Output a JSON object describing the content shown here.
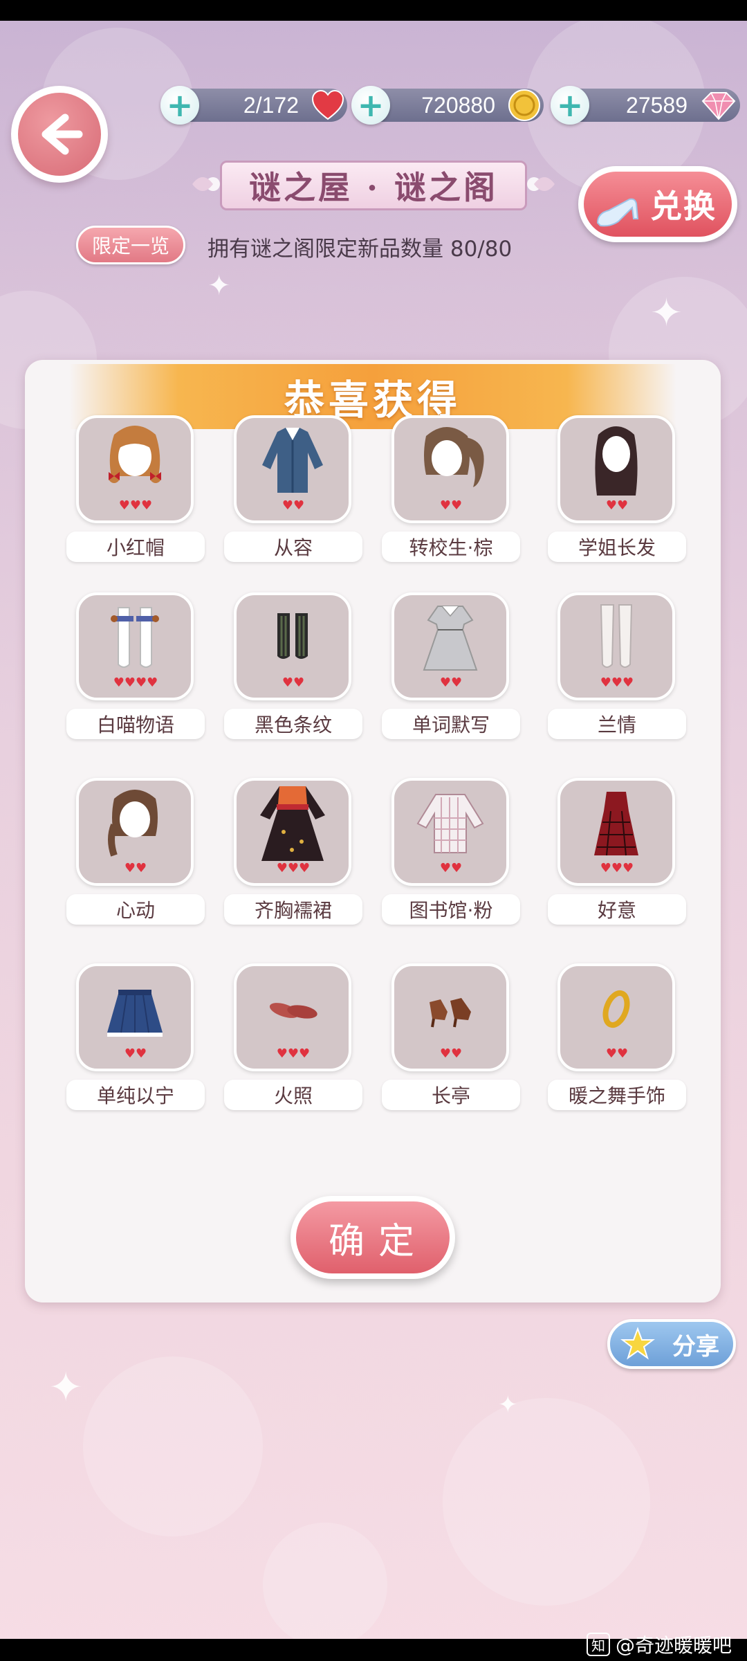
{
  "topbar": {
    "stamina": "2/172",
    "gold": "720880",
    "diamonds": "27589"
  },
  "header": {
    "title": "谜之屋 · 谜之阁",
    "exchange_label": "兑换",
    "limited_label": "限定一览",
    "owned_text": "拥有谜之阁限定新品数量 80/80"
  },
  "panel": {
    "congrats_title": "恭喜获得",
    "items": [
      {
        "name": "小红帽",
        "hearts": "♥♥♥",
        "icon": "hair-brown-bows-icon"
      },
      {
        "name": "从容",
        "hearts": "♥♥",
        "icon": "blue-coat-icon"
      },
      {
        "name": "转校生·棕",
        "hearts": "♥♥",
        "icon": "ponytail-hair-icon"
      },
      {
        "name": "学姐长发",
        "hearts": "♥♥",
        "icon": "long-dark-hair-icon"
      },
      {
        "name": "白喵物语",
        "hearts": "♥♥♥♥",
        "icon": "white-stockings-icon"
      },
      {
        "name": "黑色条纹",
        "hearts": "♥♥",
        "icon": "striped-socks-icon"
      },
      {
        "name": "单词默写",
        "hearts": "♥♥",
        "icon": "grey-dress-icon"
      },
      {
        "name": "兰情",
        "hearts": "♥♥♥",
        "icon": "white-long-stockings-icon"
      },
      {
        "name": "心动",
        "hearts": "♥♥",
        "icon": "side-braid-hair-icon"
      },
      {
        "name": "齐胸襦裙",
        "hearts": "♥♥♥",
        "icon": "hanfu-dress-icon"
      },
      {
        "name": "图书馆·粉",
        "hearts": "♥♥",
        "icon": "plaid-shirt-icon"
      },
      {
        "name": "好意",
        "hearts": "♥♥♥",
        "icon": "red-plaid-dress-icon"
      },
      {
        "name": "单纯以宁",
        "hearts": "♥♥",
        "icon": "navy-skirt-icon"
      },
      {
        "name": "火照",
        "hearts": "♥♥♥",
        "icon": "red-flats-icon"
      },
      {
        "name": "长亭",
        "hearts": "♥♥",
        "icon": "brown-heels-icon"
      },
      {
        "name": "暖之舞手饰",
        "hearts": "♥♥",
        "icon": "gold-bracelet-icon"
      }
    ],
    "confirm_label": "确定"
  },
  "share_label": "分享",
  "watermark": {
    "logo": "知",
    "text": "@奇迹暖暖吧"
  },
  "colors": {
    "accent_pink": "#e0606c",
    "heart_red": "#e0323f",
    "gold": "#f5a03c",
    "card_bg": "#d3c6c8"
  }
}
